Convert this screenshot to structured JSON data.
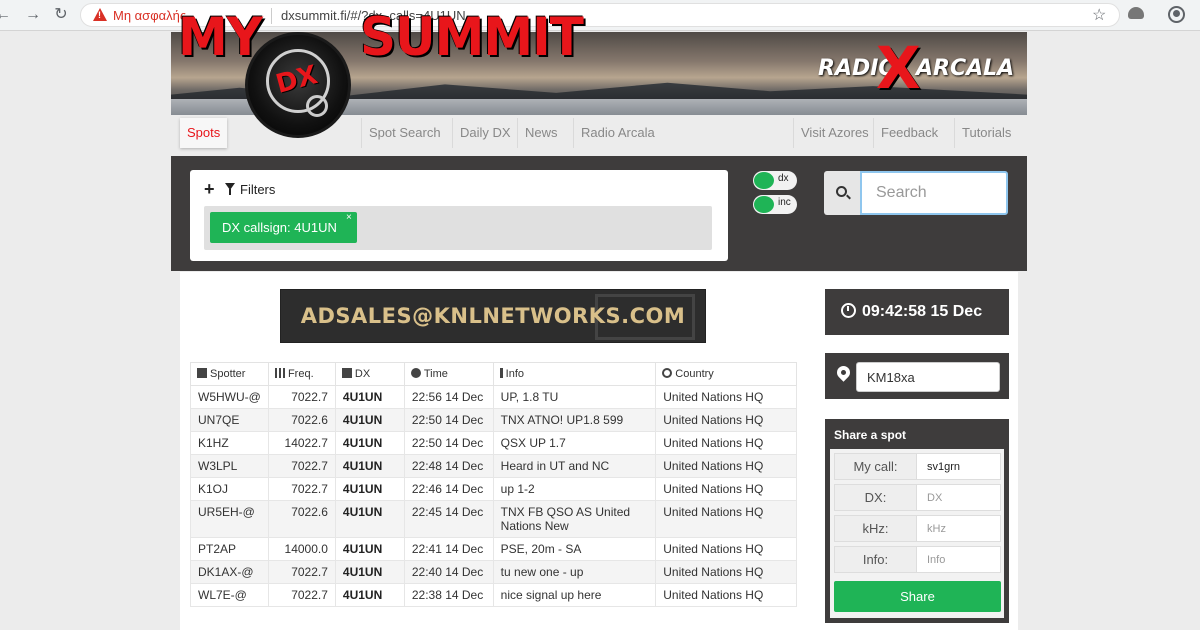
{
  "browser": {
    "insecure_label": "Μη ασφαλής",
    "url": "dxsummit.fi/#/?dx_calls=4U1UN"
  },
  "banner": {
    "logo_my": "MY",
    "logo_dx": "DX",
    "logo_summit": "SUMMIT",
    "radio_left": "RADIO",
    "radio_x": "X",
    "radio_right": "ARCALA"
  },
  "menu": {
    "items": [
      "Spots",
      "Spot Search",
      "Daily DX",
      "News",
      "Radio Arcala",
      "Visit Azores",
      "Feedback",
      "Tutorials"
    ]
  },
  "filters": {
    "label": "Filters",
    "chip": "DX callsign: 4U1UN",
    "chip_close": "×",
    "toggle_dx": "dx",
    "toggle_inc": "inc"
  },
  "search": {
    "placeholder": "Search"
  },
  "ad": {
    "text": "ADSALES@KNLNETWORKS.COM"
  },
  "clock": {
    "text": "09:42:58 15 Dec"
  },
  "locator": {
    "value": "KM18xa"
  },
  "table": {
    "headers": [
      "Spotter",
      "Freq.",
      "DX",
      "Time",
      "Info",
      "Country"
    ],
    "rows": [
      {
        "spotter": "W5HWU-@",
        "freq": "7022.7",
        "dx": "4U1UN",
        "time": "22:56 14 Dec",
        "info": "UP, 1.8 TU",
        "country": "United Nations HQ"
      },
      {
        "spotter": "UN7QE",
        "freq": "7022.6",
        "dx": "4U1UN",
        "time": "22:50 14 Dec",
        "info": "TNX ATNO! UP1.8 599",
        "country": "United Nations HQ"
      },
      {
        "spotter": "K1HZ",
        "freq": "14022.7",
        "dx": "4U1UN",
        "time": "22:50 14 Dec",
        "info": "QSX UP 1.7",
        "country": "United Nations HQ"
      },
      {
        "spotter": "W3LPL",
        "freq": "7022.7",
        "dx": "4U1UN",
        "time": "22:48 14 Dec",
        "info": "Heard in UT and NC",
        "country": "United Nations HQ"
      },
      {
        "spotter": "K1OJ",
        "freq": "7022.7",
        "dx": "4U1UN",
        "time": "22:46 14 Dec",
        "info": "up 1-2",
        "country": "United Nations HQ"
      },
      {
        "spotter": "UR5EH-@",
        "freq": "7022.6",
        "dx": "4U1UN",
        "time": "22:45 14 Dec",
        "info": "TNX FB QSO AS United Nations New",
        "country": "United Nations HQ"
      },
      {
        "spotter": "PT2AP",
        "freq": "14000.0",
        "dx": "4U1UN",
        "time": "22:41 14 Dec",
        "info": "PSE, 20m - SA",
        "country": "United Nations HQ"
      },
      {
        "spotter": "DK1AX-@",
        "freq": "7022.7",
        "dx": "4U1UN",
        "time": "22:40 14 Dec",
        "info": "tu new one - up",
        "country": "United Nations HQ"
      },
      {
        "spotter": "WL7E-@",
        "freq": "7022.7",
        "dx": "4U1UN",
        "time": "22:38 14 Dec",
        "info": "nice signal up here",
        "country": "United Nations HQ"
      }
    ]
  },
  "share": {
    "title": "Share a spot",
    "mycall_label": "My call:",
    "mycall_value": "sv1grn",
    "dx_label": "DX:",
    "dx_placeholder": "DX",
    "khz_label": "kHz:",
    "khz_placeholder": "kHz",
    "info_label": "Info:",
    "info_placeholder": "Info",
    "button": "Share"
  }
}
